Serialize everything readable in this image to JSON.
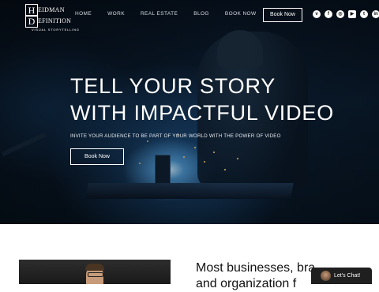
{
  "header": {
    "logo": {
      "letter_top": "H",
      "word_top": "EIDMAN",
      "letter_bottom": "D",
      "word_bottom": "EFINITION",
      "tagline": "VISUAL STORYTELLING"
    },
    "nav": [
      "HOME",
      "WORK",
      "REAL ESTATE",
      "BLOG",
      "BOOK NOW"
    ],
    "book_button": "Book Now",
    "socials": [
      {
        "icon": "vimeo-icon",
        "glyph": "v"
      },
      {
        "icon": "facebook-icon",
        "glyph": "f"
      },
      {
        "icon": "instagram-icon",
        "glyph": "◎"
      },
      {
        "icon": "youtube-icon",
        "glyph": "▶"
      },
      {
        "icon": "twitter-icon",
        "glyph": "t"
      },
      {
        "icon": "linkedin-icon",
        "glyph": "in"
      }
    ]
  },
  "hero": {
    "line1": "TELL YOUR STORY",
    "line2": "WITH IMPACTFUL VIDEO",
    "subtitle": "INVITE YOUR AUDIENCE TO BE PART OF YOUR WORLD WITH THE POWER OF VIDEO",
    "button": "Book Now"
  },
  "about": {
    "line1": "Most businesses, bra",
    "line2": "and organization f"
  },
  "chat": {
    "label": "Let's Chat!"
  },
  "colors": {
    "hero_dark": "#07111d",
    "weld_glow": "#8fd0ff",
    "chat_bg": "#1f1f1f"
  }
}
